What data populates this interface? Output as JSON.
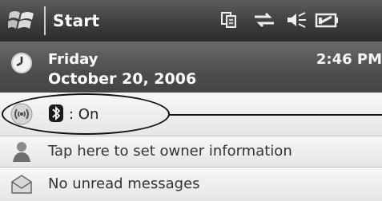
{
  "titlebar": {
    "start_label": "Start",
    "tray_icons": [
      "multitask-icon",
      "connectivity-icon",
      "speaker-muted-icon",
      "battery-icon"
    ]
  },
  "today": {
    "day": "Friday",
    "date": "October 20, 2006",
    "time": "2:46 PM"
  },
  "bluetooth": {
    "status_text": ": On"
  },
  "owner": {
    "text": "Tap here to set owner information"
  },
  "messages": {
    "text": "No unread messages"
  }
}
